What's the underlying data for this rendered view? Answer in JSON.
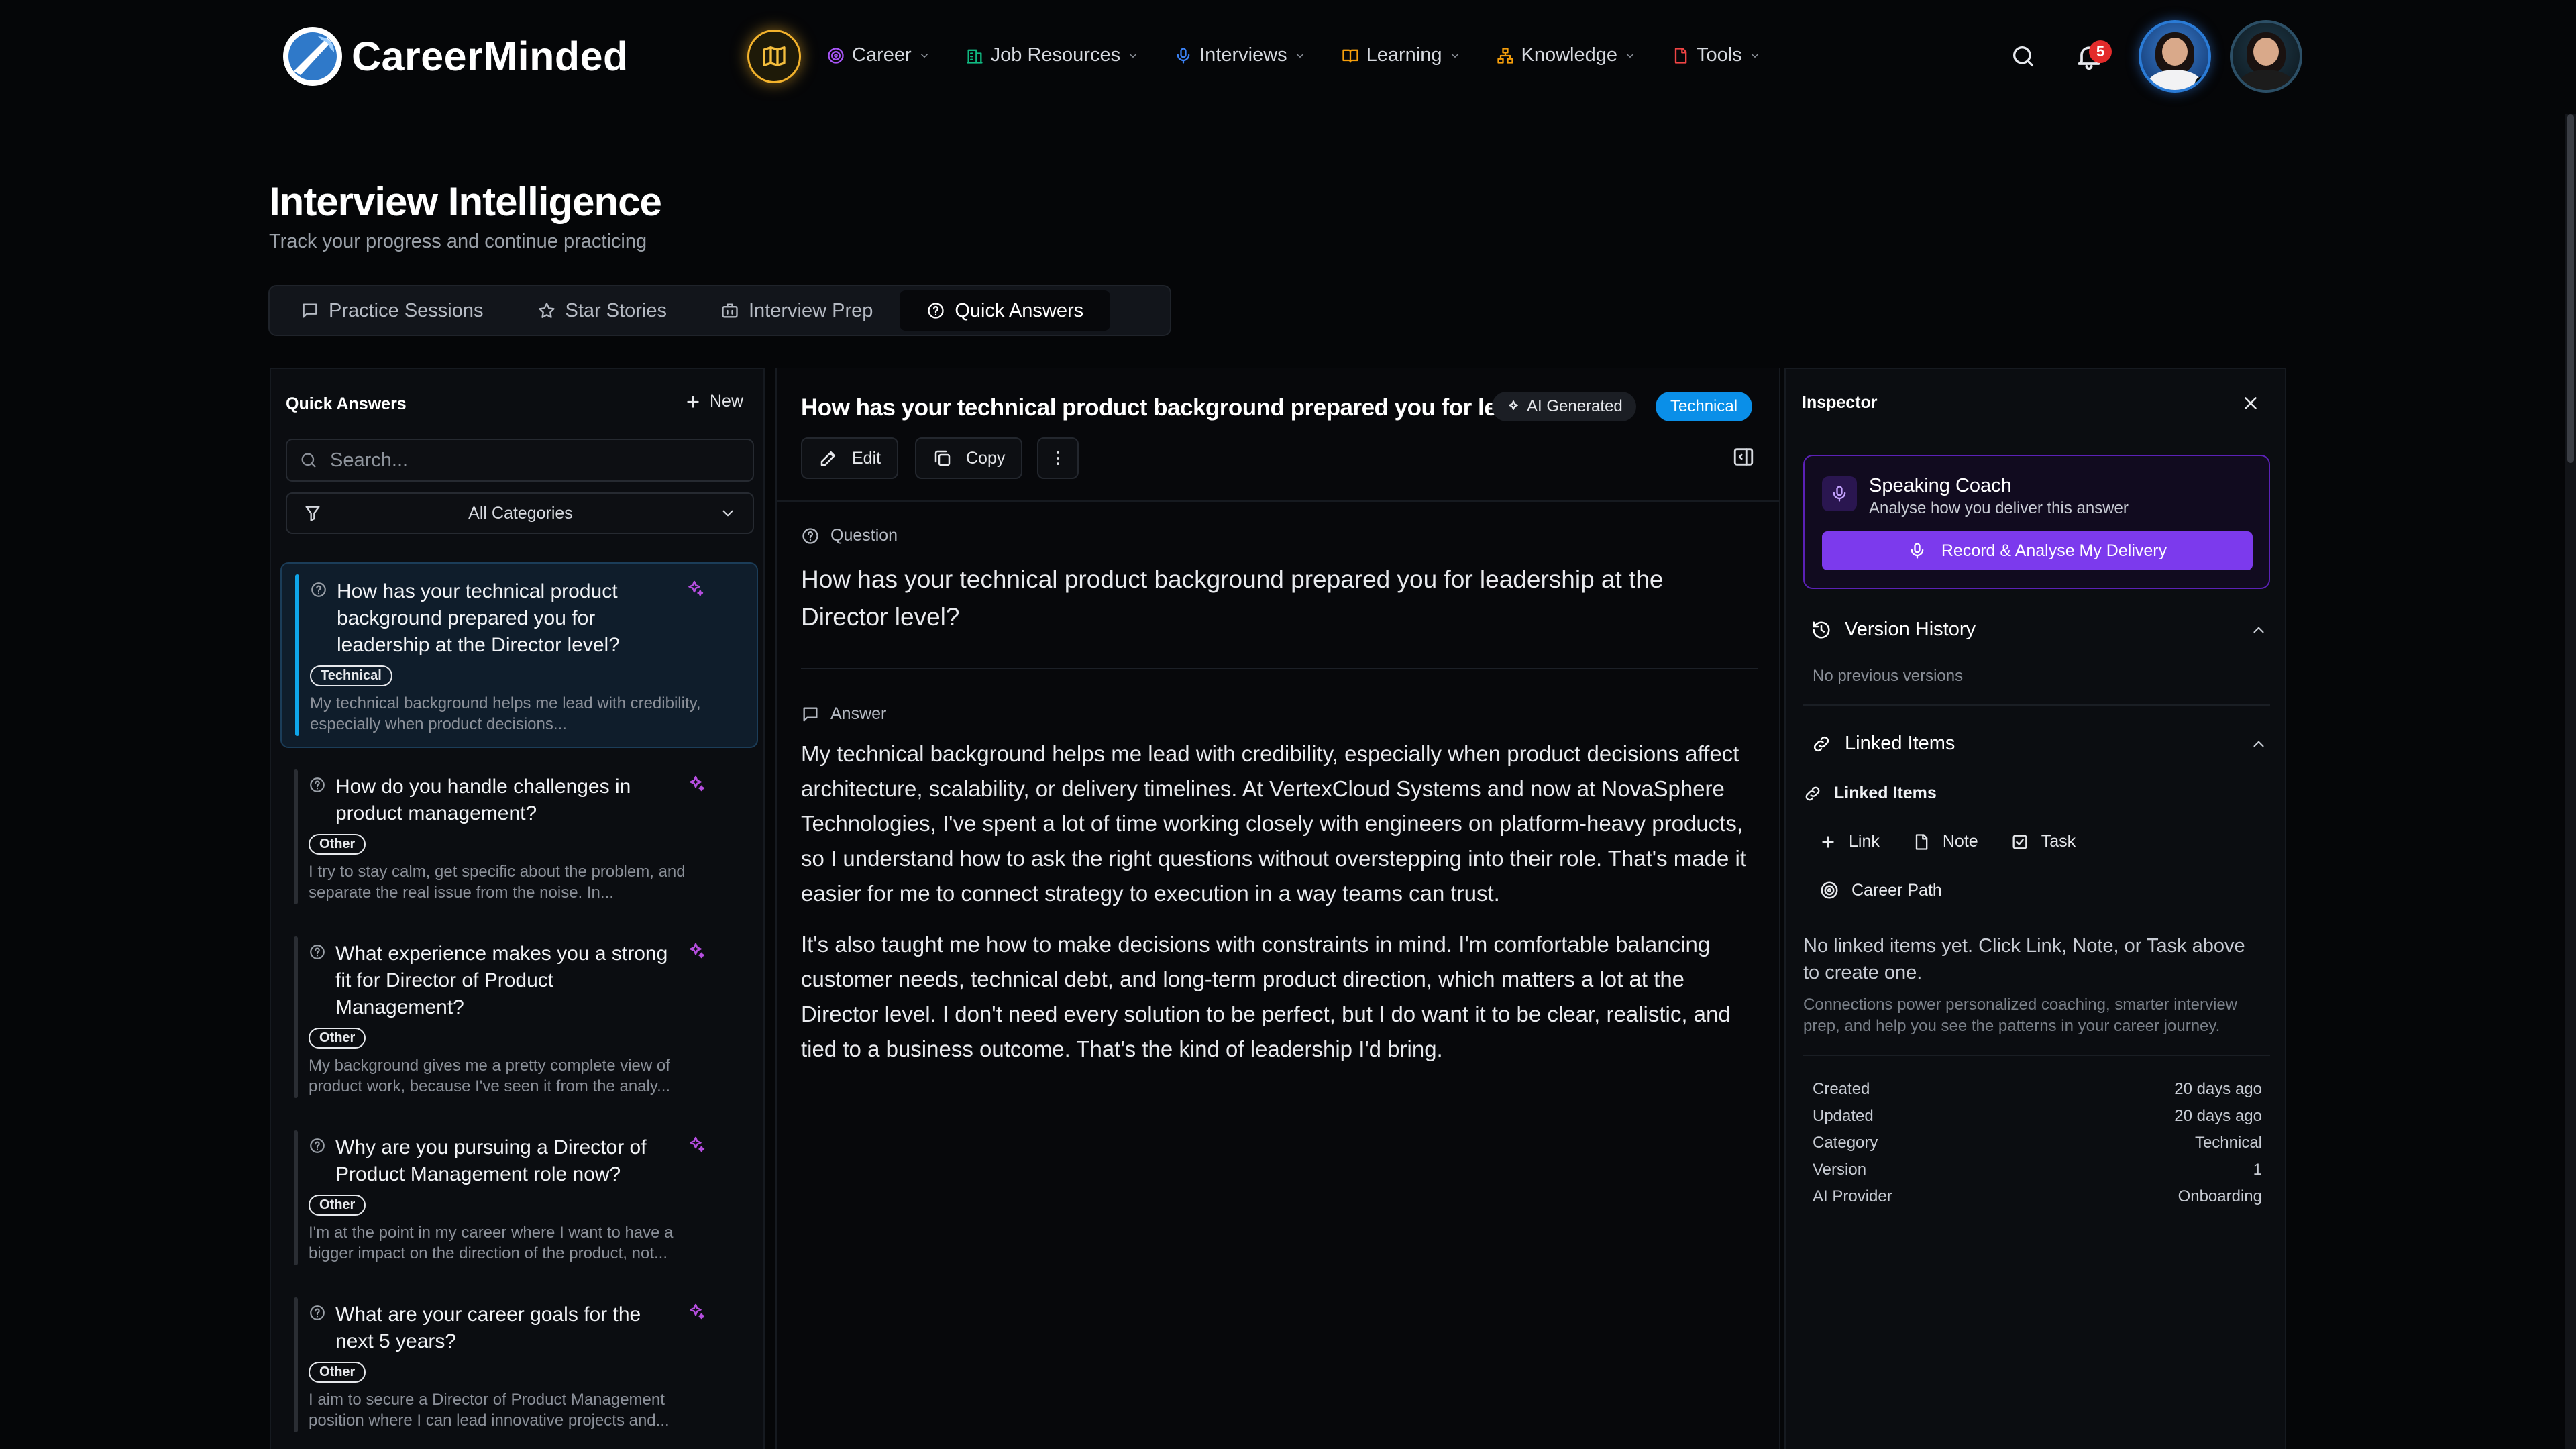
{
  "brand": {
    "name": "CareerMinded"
  },
  "nav": [
    {
      "label": "Career",
      "icon": "target-icon",
      "color": "#a855f7"
    },
    {
      "label": "Job Resources",
      "icon": "building-icon",
      "color": "#10b981"
    },
    {
      "label": "Interviews",
      "icon": "mic-icon",
      "color": "#3b82f6"
    },
    {
      "label": "Learning",
      "icon": "book-icon",
      "color": "#f59e0b"
    },
    {
      "label": "Knowledge",
      "icon": "network-icon",
      "color": "#f59e0b"
    },
    {
      "label": "Tools",
      "icon": "file-icon",
      "color": "#ef4444"
    }
  ],
  "header": {
    "notifications_count": "5"
  },
  "page": {
    "title": "Interview Intelligence",
    "subtitle": "Track your progress and continue practicing"
  },
  "tabs": [
    {
      "label": "Practice Sessions",
      "icon": "chat-icon"
    },
    {
      "label": "Star Stories",
      "icon": "star-icon"
    },
    {
      "label": "Interview Prep",
      "icon": "briefcase-icon"
    },
    {
      "label": "Quick Answers",
      "icon": "help-circle-icon",
      "active": true
    }
  ],
  "left": {
    "title": "Quick Answers",
    "new_label": "New",
    "search_placeholder": "Search...",
    "filter_label": "All Categories",
    "items": [
      {
        "question": "How has your technical product background prepared you for leadership at the Director level?",
        "tag": "Technical",
        "preview": "My technical background helps me lead with credibility, especially when product decisions..."
      },
      {
        "question": "How do you handle challenges in product management?",
        "tag": "Other",
        "preview": "I try to stay calm, get specific about the problem, and separate the real issue from the noise. In..."
      },
      {
        "question": "What experience makes you a strong fit for Director of Product Management?",
        "tag": "Other",
        "preview": "My background gives me a pretty complete view of product work, because I've seen it from the analy..."
      },
      {
        "question": "Why are you pursuing a Director of Product Management role now?",
        "tag": "Other",
        "preview": "I'm at the point in my career where I want to have a bigger impact on the direction of the product, not..."
      },
      {
        "question": "What are your career goals for the next 5 years?",
        "tag": "Other",
        "preview": "I aim to secure a Director of Product Management position where I can lead innovative projects and..."
      }
    ]
  },
  "main": {
    "title": "How has your technical product background prepared you for le...",
    "ai_badge": "AI Generated",
    "category_badge": "Technical",
    "edit_label": "Edit",
    "copy_label": "Copy",
    "question_label": "Question",
    "question": "How has your technical product background prepared you for leadership at the Director level?",
    "answer_label": "Answer",
    "answer_p1": "My technical background helps me lead with credibility, especially when product decisions affect architecture, scalability, or delivery timelines. At VertexCloud Systems and now at NovaSphere Technologies, I've spent a lot of time working closely with engineers on platform-heavy products, so I understand how to ask the right questions without overstepping into their role. That's made it easier for me to connect strategy to execution in a way teams can trust.",
    "answer_p2": "It's also taught me how to make decisions with constraints in mind. I'm comfortable balancing customer needs, technical debt, and long-term product direction, which matters a lot at the Director level. I don't need every solution to be perfect, but I do want it to be clear, realistic, and tied to a business outcome. That's the kind of leadership I'd bring."
  },
  "inspector": {
    "title": "Inspector",
    "coach_title": "Speaking Coach",
    "coach_sub": "Analyse how you deliver this answer",
    "coach_button": "Record & Analyse My Delivery",
    "version_title": "Version History",
    "version_empty": "No previous versions",
    "linked_title": "Linked Items",
    "linked_label": "Linked Items",
    "link_label": "Link",
    "note_label": "Note",
    "task_label": "Task",
    "career_path_label": "Career Path",
    "empty_text": "No linked items yet. Click Link, Note, or Task above to create one.",
    "connections_text": "Connections power personalized coaching, smarter interview prep, and help you see the patterns in your career journey.",
    "meta": [
      {
        "k": "Created",
        "v": "20 days ago"
      },
      {
        "k": "Updated",
        "v": "20 days ago"
      },
      {
        "k": "Category",
        "v": "Technical"
      },
      {
        "k": "Version",
        "v": "1"
      },
      {
        "k": "AI Provider",
        "v": "Onboarding"
      }
    ]
  }
}
